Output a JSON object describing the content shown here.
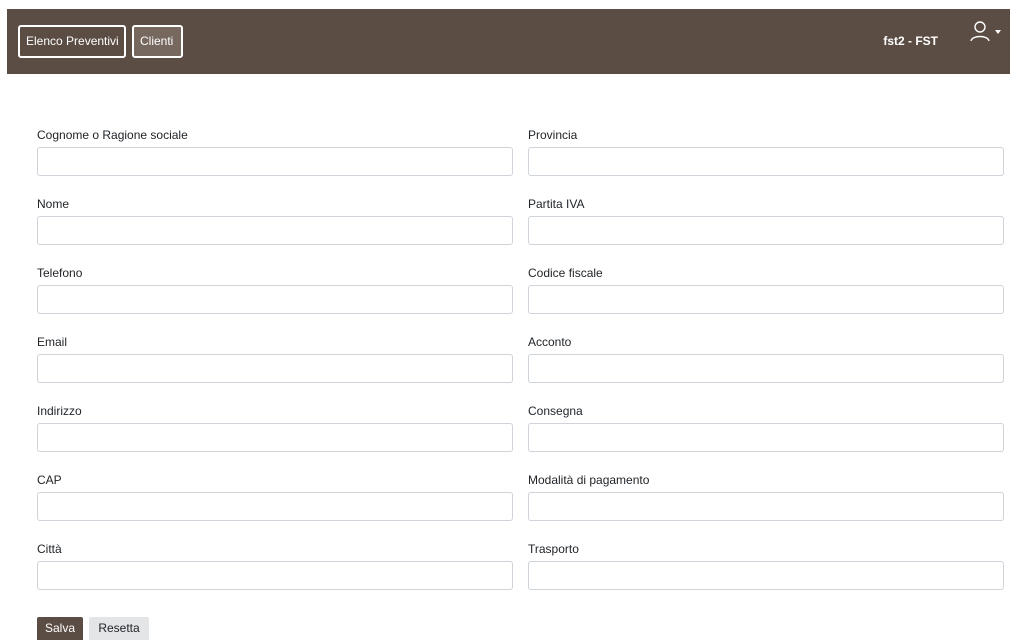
{
  "navbar": {
    "tabs": [
      "Elenco Preventivi",
      "Clienti"
    ],
    "user_label": "fst2 - FST",
    "avatar_icon": "user-icon",
    "caret_icon": "chevron-down-icon",
    "background": "#5b4d44"
  },
  "form": {
    "left_fields": [
      {
        "label": "Cognome o Ragione sociale",
        "value": ""
      },
      {
        "label": "Nome",
        "value": ""
      },
      {
        "label": "Telefono",
        "value": ""
      },
      {
        "label": "Email",
        "value": ""
      },
      {
        "label": "Indirizzo",
        "value": ""
      },
      {
        "label": "CAP",
        "value": ""
      },
      {
        "label": "Città",
        "value": ""
      }
    ],
    "right_fields": [
      {
        "label": "Provincia",
        "value": ""
      },
      {
        "label": "Partita IVA",
        "value": ""
      },
      {
        "label": "Codice fiscale",
        "value": ""
      },
      {
        "label": "Acconto",
        "value": ""
      },
      {
        "label": "Consegna",
        "value": ""
      },
      {
        "label": "Modalità di pagamento",
        "value": ""
      },
      {
        "label": "Trasporto",
        "value": ""
      }
    ]
  },
  "buttons": {
    "save_label": "Salva",
    "reset_label": "Resetta"
  }
}
